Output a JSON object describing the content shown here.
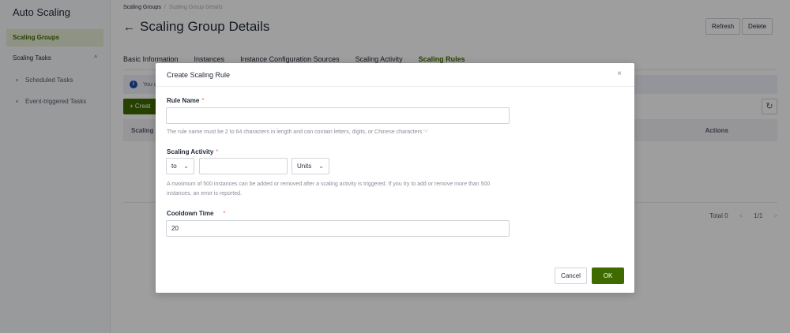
{
  "sidebar": {
    "title": "Auto Scaling",
    "items": [
      {
        "label": "Scaling Groups"
      },
      {
        "label": "Scaling Tasks",
        "caret": "^"
      }
    ],
    "sub_items": [
      {
        "label": "Scheduled Tasks"
      },
      {
        "label": "Event-triggered Tasks"
      }
    ]
  },
  "breadcrumb": {
    "parent": "Scaling Groups",
    "separator": "/",
    "current": "Scaling Group Details"
  },
  "header": {
    "back": "←",
    "title": "Scaling Group Details",
    "refresh_label": "Refresh",
    "delete_label": "Delete"
  },
  "tabs": [
    {
      "label": "Basic Information"
    },
    {
      "label": "Instances"
    },
    {
      "label": "Instance Configuration Sources"
    },
    {
      "label": "Scaling Activity"
    },
    {
      "label": "Scaling Rules"
    }
  ],
  "info_bar": {
    "text": "You c"
  },
  "toolbar": {
    "create_label": "+ Creat",
    "refresh_icon": "↻"
  },
  "table": {
    "col_name": "Scaling R",
    "col_actions": "Actions"
  },
  "pager": {
    "total": "Total 0",
    "prev": "<",
    "page": "1/1",
    "next": ">"
  },
  "modal": {
    "title": "Create Scaling Rule",
    "close": "×",
    "rule_name": {
      "label": "Rule Name",
      "required": "*",
      "value": "",
      "hint": "The rule name must be 2 to 64 characters in length and can contain letters, digits, or Chinese characters '-'"
    },
    "scaling_activity": {
      "label": "Scaling Activity",
      "required": "*",
      "direction": "to",
      "amount": "",
      "unit": "Units",
      "hint": "A maximum of 500 instances can be added or removed after a scaling activity is triggered. If you try to add or remove more than 500 instances, an error is reported."
    },
    "cooldown": {
      "label": "Cooldown Time",
      "required": "*",
      "value": "20"
    },
    "cancel_label": "Cancel",
    "ok_label": "OK"
  },
  "colors": {
    "accent": "#3f6a00",
    "info": "#1e4aa8",
    "required": "#f66f6a"
  }
}
